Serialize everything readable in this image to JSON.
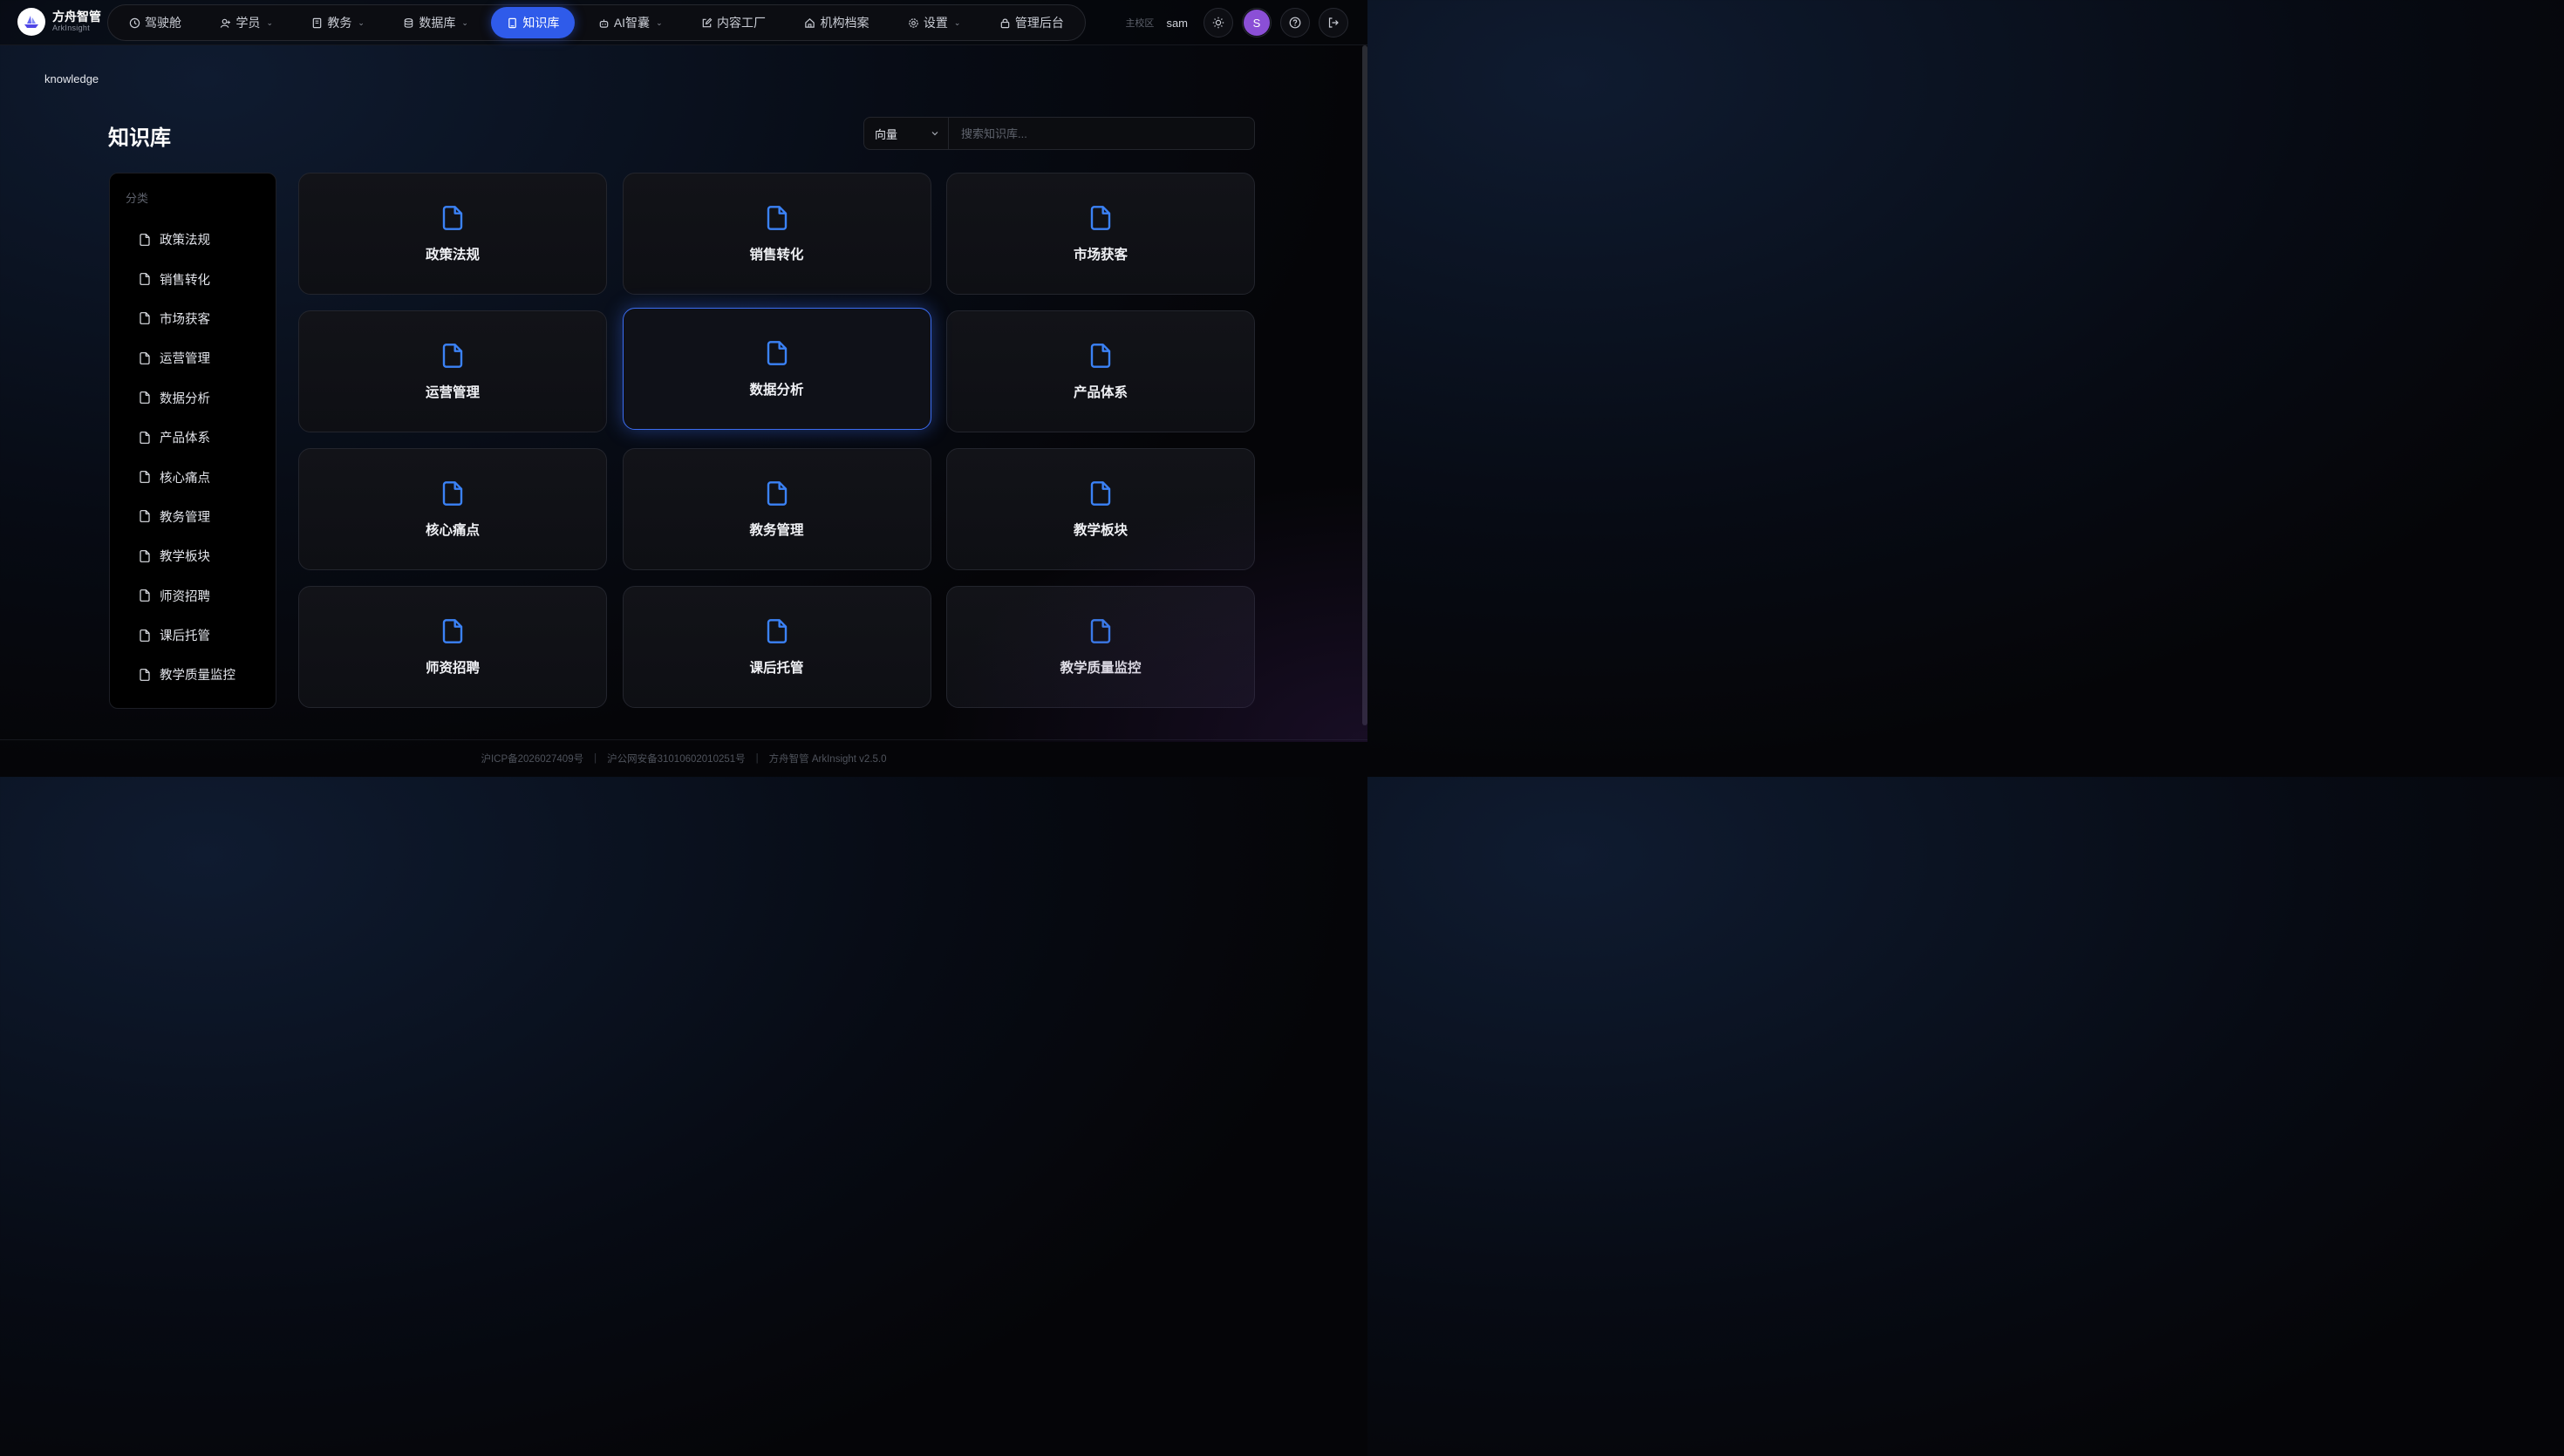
{
  "brand": {
    "name": "方舟智管",
    "subtitle": "ArkInsight"
  },
  "nav": {
    "items": [
      {
        "label": "驾驶舱",
        "icon": "clock-icon",
        "dropdown": false,
        "active": false
      },
      {
        "label": "学员",
        "icon": "user-plus-icon",
        "dropdown": true,
        "active": false
      },
      {
        "label": "教务",
        "icon": "book-icon",
        "dropdown": true,
        "active": false
      },
      {
        "label": "数据库",
        "icon": "database-icon",
        "dropdown": true,
        "active": false
      },
      {
        "label": "知识库",
        "icon": "notebook-icon",
        "dropdown": false,
        "active": true
      },
      {
        "label": "AI智囊",
        "icon": "robot-icon",
        "dropdown": true,
        "active": false
      },
      {
        "label": "内容工厂",
        "icon": "edit-icon",
        "dropdown": false,
        "active": false
      },
      {
        "label": "机构档案",
        "icon": "home-icon",
        "dropdown": false,
        "active": false
      },
      {
        "label": "设置",
        "icon": "gear-icon",
        "dropdown": true,
        "active": false
      },
      {
        "label": "管理后台",
        "icon": "lock-icon",
        "dropdown": false,
        "active": false
      }
    ]
  },
  "header_right": {
    "campus": "主校区",
    "username": "sam",
    "avatar_initial": "S"
  },
  "breadcrumb": "knowledge",
  "page_title": "知识库",
  "search": {
    "mode": "向量",
    "placeholder": "搜索知识库..."
  },
  "sidebar": {
    "heading": "分类",
    "items": [
      "政策法规",
      "销售转化",
      "市场获客",
      "运营管理",
      "数据分析",
      "产品体系",
      "核心痛点",
      "教务管理",
      "教学板块",
      "师资招聘",
      "课后托管",
      "教学质量监控"
    ]
  },
  "cards": [
    {
      "label": "政策法规",
      "active": false
    },
    {
      "label": "销售转化",
      "active": false
    },
    {
      "label": "市场获客",
      "active": false
    },
    {
      "label": "运营管理",
      "active": false
    },
    {
      "label": "数据分析",
      "active": true
    },
    {
      "label": "产品体系",
      "active": false
    },
    {
      "label": "核心痛点",
      "active": false
    },
    {
      "label": "教务管理",
      "active": false
    },
    {
      "label": "教学板块",
      "active": false
    },
    {
      "label": "师资招聘",
      "active": false
    },
    {
      "label": "课后托管",
      "active": false
    },
    {
      "label": "教学质量监控",
      "active": false
    }
  ],
  "footer": {
    "icp": "沪ICP备2026027409号",
    "police": "沪公网安备31010602010251号",
    "version": "方舟智管 ArkInsight v2.5.0"
  },
  "colors": {
    "accent": "#2f5bea",
    "icon_blue": "#3b82f6",
    "avatar": "#8b4fd6"
  }
}
